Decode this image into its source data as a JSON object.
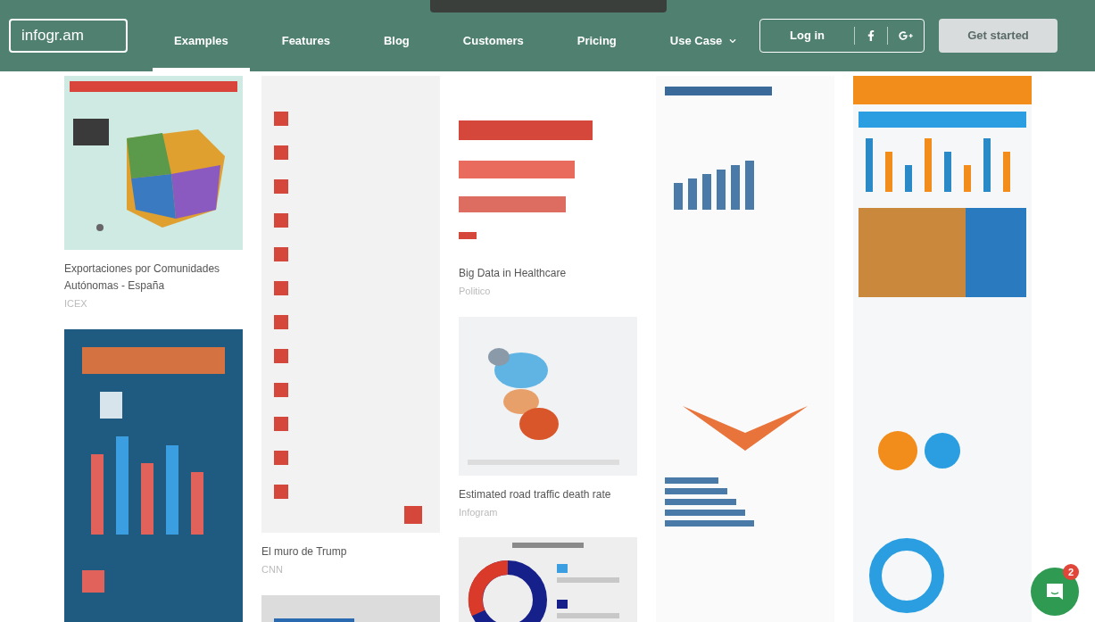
{
  "nav": {
    "logo": "infogr.am",
    "links": [
      {
        "label": "Examples",
        "selected": true
      },
      {
        "label": "Features",
        "selected": false
      },
      {
        "label": "Blog",
        "selected": false
      },
      {
        "label": "Customers",
        "selected": false
      },
      {
        "label": "Pricing",
        "selected": false
      },
      {
        "label": "Use Case",
        "selected": false,
        "dropdown": true
      }
    ],
    "login": "Log in",
    "cta": "Get started"
  },
  "columns": [
    {
      "cards": [
        {
          "kind": "picture",
          "title": "Exportaciones por Comunidades Autónomas - España",
          "source": "ICEX"
        },
        {
          "kind": "picture"
        }
      ]
    },
    {
      "cards": [
        {
          "kind": "picture",
          "title": "El muro de Trump",
          "source": "CNN"
        },
        {
          "kind": "picture"
        }
      ]
    },
    {
      "cards": [
        {
          "kind": "picture",
          "title": "Big Data in Healthcare",
          "source": "Politico"
        },
        {
          "kind": "picture",
          "title": "Estimated road traffic death rate",
          "source": "Infogram"
        },
        {
          "kind": "picture"
        }
      ]
    },
    {
      "cards": [
        {
          "kind": "picture"
        }
      ]
    },
    {
      "cards": [
        {
          "kind": "picture"
        }
      ]
    }
  ],
  "chat": {
    "badge": "2"
  }
}
